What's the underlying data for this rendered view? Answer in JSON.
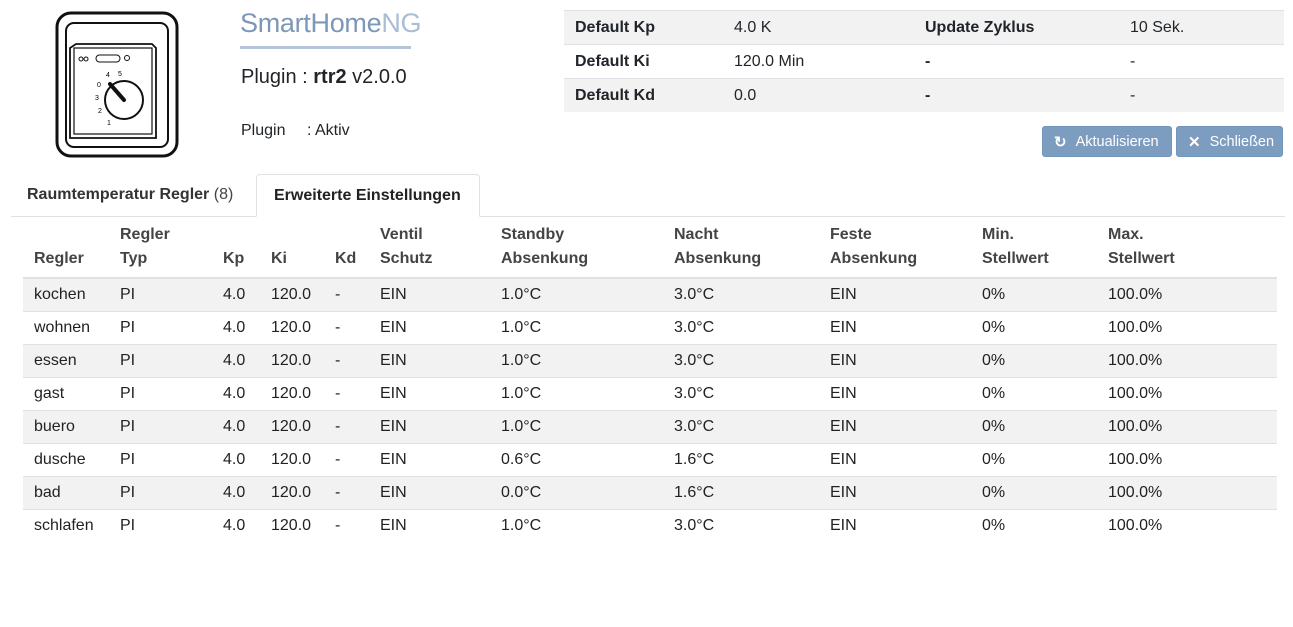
{
  "header": {
    "logo_main": "SmartHome",
    "logo_suffix": "NG",
    "plugin_prefix": "Plugin : ",
    "plugin_name": "rtr2",
    "plugin_version": " v2.0.0",
    "status_label": "Plugin",
    "status_value": ": Aktiv"
  },
  "device_dial": [
    "1",
    "2",
    "3",
    "0",
    "4",
    "5"
  ],
  "info": {
    "rows": [
      [
        "Default Kp",
        "4.0 K",
        "Update Zyklus",
        "10 Sek."
      ],
      [
        "Default Ki",
        "120.0 Min",
        "-",
        "-"
      ],
      [
        "Default Kd",
        "0.0",
        "-",
        "-"
      ]
    ]
  },
  "buttons": {
    "refresh_label": "Aktualisieren",
    "close_label": "Schließen"
  },
  "tabs": {
    "tab1_label": "Raumtemperatur Regler",
    "tab1_count": "(8)",
    "tab2_label": "Erweiterte Einstellungen"
  },
  "table": {
    "headers": [
      [
        "",
        "Regler"
      ],
      [
        "Regler",
        "Typ"
      ],
      [
        "",
        "Kp"
      ],
      [
        "",
        "Ki"
      ],
      [
        "",
        "Kd"
      ],
      [
        "Ventil",
        "Schutz"
      ],
      [
        "Standby",
        "Absenkung"
      ],
      [
        "Nacht",
        "Absenkung"
      ],
      [
        "Feste",
        "Absenkung"
      ],
      [
        "Min.",
        "Stellwert"
      ],
      [
        "Max.",
        "Stellwert"
      ]
    ],
    "rows": [
      [
        "kochen",
        "PI",
        "4.0",
        "120.0",
        "-",
        "EIN",
        "1.0°C",
        "3.0°C",
        "EIN",
        "0%",
        "100.0%"
      ],
      [
        "wohnen",
        "PI",
        "4.0",
        "120.0",
        "-",
        "EIN",
        "1.0°C",
        "3.0°C",
        "EIN",
        "0%",
        "100.0%"
      ],
      [
        "essen",
        "PI",
        "4.0",
        "120.0",
        "-",
        "EIN",
        "1.0°C",
        "3.0°C",
        "EIN",
        "0%",
        "100.0%"
      ],
      [
        "gast",
        "PI",
        "4.0",
        "120.0",
        "-",
        "EIN",
        "1.0°C",
        "3.0°C",
        "EIN",
        "0%",
        "100.0%"
      ],
      [
        "buero",
        "PI",
        "4.0",
        "120.0",
        "-",
        "EIN",
        "1.0°C",
        "3.0°C",
        "EIN",
        "0%",
        "100.0%"
      ],
      [
        "dusche",
        "PI",
        "4.0",
        "120.0",
        "-",
        "EIN",
        "0.6°C",
        "1.6°C",
        "EIN",
        "0%",
        "100.0%"
      ],
      [
        "bad",
        "PI",
        "4.0",
        "120.0",
        "-",
        "EIN",
        "0.0°C",
        "1.6°C",
        "EIN",
        "0%",
        "100.0%"
      ],
      [
        "schlafen",
        "PI",
        "4.0",
        "120.0",
        "-",
        "EIN",
        "1.0°C",
        "3.0°C",
        "EIN",
        "0%",
        "100.0%"
      ]
    ]
  }
}
